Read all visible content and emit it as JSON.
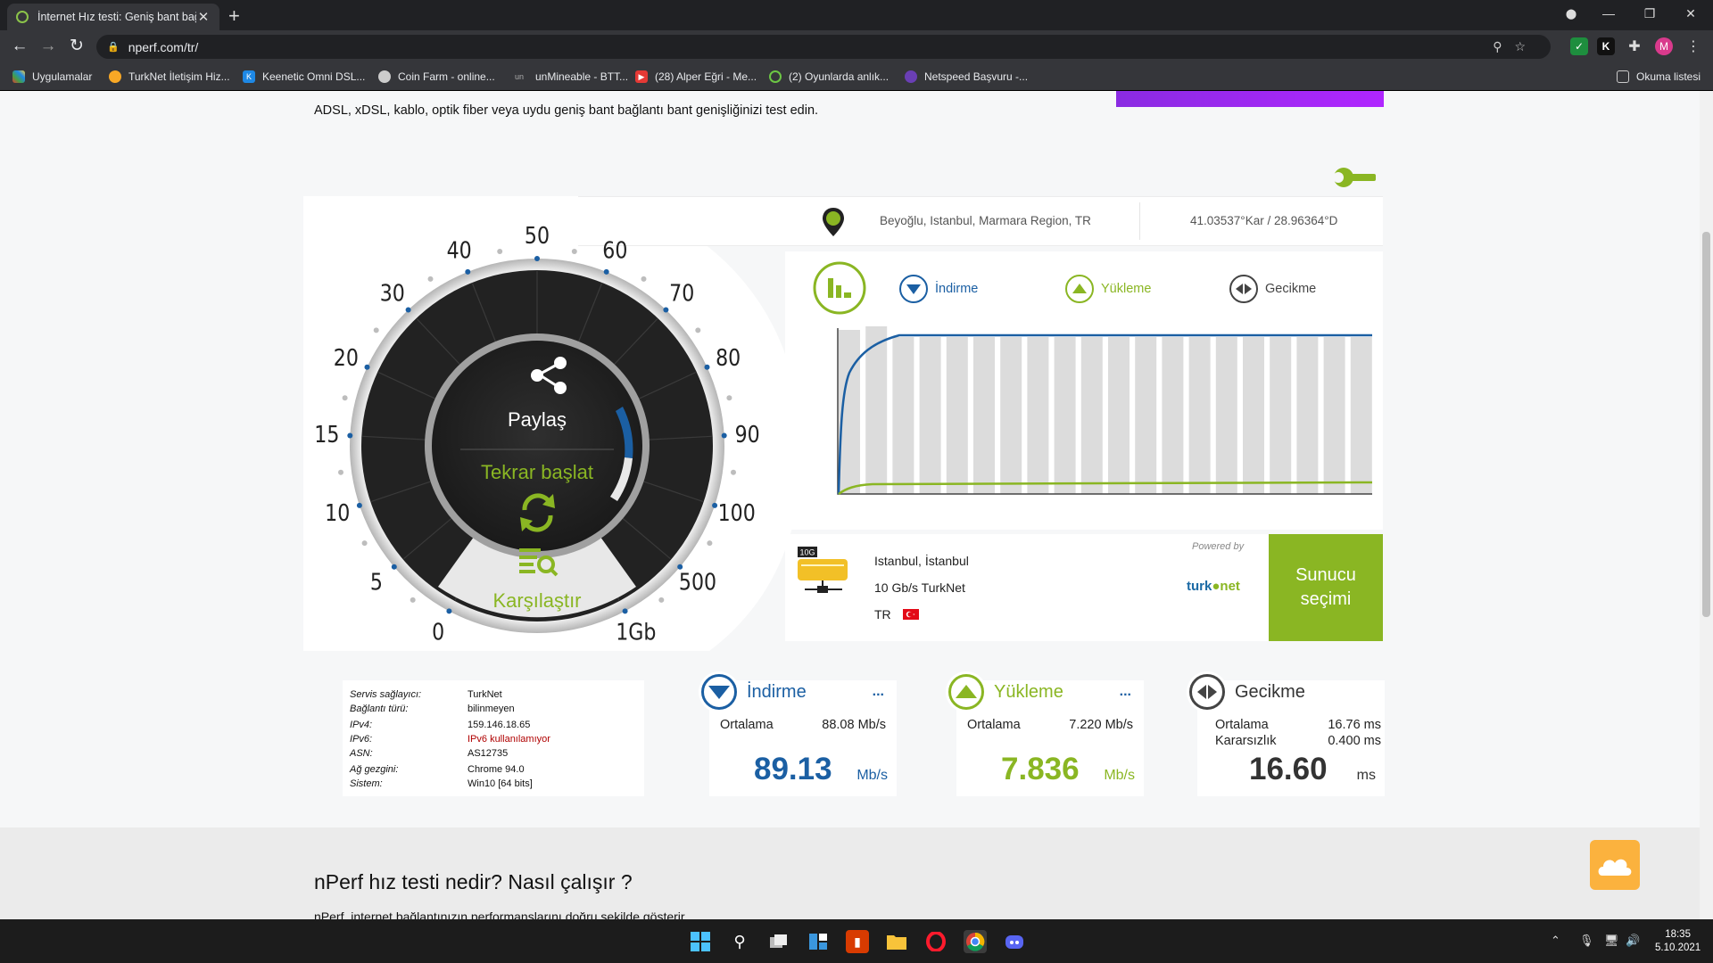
{
  "browser": {
    "tab_title": "İnternet Hız testi: Geniş bant bağl",
    "url": "nperf.com/tr/",
    "bookmarks": [
      "Uygulamalar",
      "TurkNet İletişim Hiz...",
      "Keenetic Omni DSL...",
      "Coin Farm - online...",
      "unMineable - BTT...",
      "(28) Alper Eğri - Me...",
      "(2) Oyunlarda anlık...",
      "Netspeed Başvuru -..."
    ],
    "reading_list": "Okuma listesi",
    "profile_initial": "M"
  },
  "page": {
    "intro": "ADSL, xDSL, kablo, optik fiber veya uydu geniş bant bağlantı bant genişliğinizi test edin.",
    "location": {
      "place": "Beyoğlu, Istanbul, Marmara Region, TR",
      "coords": "41.03537°Kar / 28.96364°D"
    },
    "gauge": {
      "ticks": [
        "0",
        "5",
        "10",
        "15",
        "20",
        "30",
        "40",
        "50",
        "60",
        "70",
        "80",
        "90",
        "100",
        "500",
        "1Gb"
      ],
      "share": "Paylaş",
      "restart": "Tekrar başlat",
      "compare": "Karşılaştır"
    },
    "legend": {
      "download": "İndirme",
      "upload": "Yükleme",
      "latency": "Gecikme"
    },
    "server": {
      "badge": "10G",
      "city": "Istanbul, İstanbul",
      "network": "10 Gb/s TurkNet",
      "country": "TR",
      "powered_by": "Powered by",
      "select_label": "Sunucu seçimi"
    },
    "info": [
      {
        "k": "Servis sağlayıcı:",
        "v": "TurkNet"
      },
      {
        "k": "Bağlantı türü:",
        "v": "bilinmeyen"
      },
      {
        "k": "IPv4:",
        "v": "159.146.18.65"
      },
      {
        "k": "IPv6:",
        "v": "IPv6 kullanılamıyor"
      },
      {
        "k": "ASN:",
        "v": "AS12735"
      },
      {
        "k": "Ağ gezgini:",
        "v": "Chrome 94.0"
      },
      {
        "k": "Sistem:",
        "v": "Win10 [64 bits]"
      }
    ],
    "download": {
      "label": "İndirme",
      "avg_label": "Ortalama",
      "avg": "88.08 Mb/s",
      "value": "89.13",
      "unit": "Mb/s"
    },
    "upload": {
      "label": "Yükleme",
      "avg_label": "Ortalama",
      "avg": "7.220 Mb/s",
      "value": "7.836",
      "unit": "Mb/s"
    },
    "latency": {
      "label": "Gecikme",
      "avg_label": "Ortalama",
      "avg": "16.76 ms",
      "jitter_label": "Kararsızlık",
      "jitter": "0.400 ms",
      "value": "16.60",
      "unit": "ms"
    },
    "lower_title": "nPerf hız testi nedir? Nasıl çalışır ?",
    "lower_text": "nPerf, internet bağlantınızın performanslarını doğru şekilde gösterir"
  },
  "taskbar": {
    "time": "18:35",
    "date": "5.10.2021"
  },
  "colors": {
    "download": "#1b5fa3",
    "upload": "#8ab623",
    "latency": "#444444",
    "accent_green": "#8ab623"
  }
}
